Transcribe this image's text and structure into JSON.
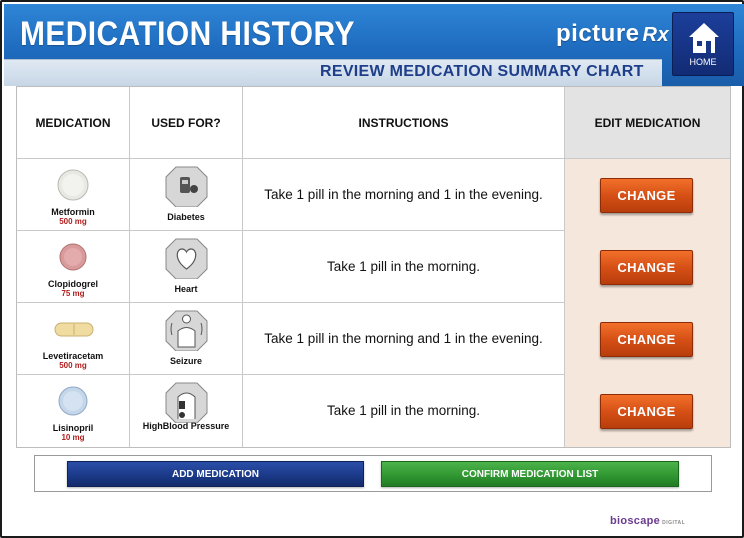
{
  "header": {
    "title": "MEDICATION HISTORY",
    "logo": "picture",
    "logo_rx": "Rx",
    "subtitle": "REVIEW MEDICATION SUMMARY CHART",
    "home_label": "HOME"
  },
  "table": {
    "headers": {
      "medication": "MEDICATION",
      "used_for": "USED FOR?",
      "instructions": "INSTRUCTIONS",
      "edit": "EDIT MEDICATION"
    },
    "rows": [
      {
        "medication": "Metformin",
        "dose": "500 mg",
        "used_for": "Diabetes",
        "instructions": "Take 1 pill in the morning and 1 in the evening.",
        "action": "CHANGE"
      },
      {
        "medication": "Clopidogrel",
        "dose": "75 mg",
        "used_for": "Heart",
        "instructions": "Take 1 pill in the morning.",
        "action": "CHANGE"
      },
      {
        "medication": "Levetiracetam",
        "dose": "500 mg",
        "used_for": "Seizure",
        "instructions": "Take 1 pill in the morning and 1 in the evening.",
        "action": "CHANGE"
      },
      {
        "medication": "Lisinopril",
        "dose": "10 mg",
        "used_for": "HighBlood Pressure",
        "instructions": "Take 1 pill in the morning.",
        "action": "CHANGE"
      }
    ]
  },
  "actions": {
    "add": "ADD MEDICATION",
    "confirm": "CONFIRM MEDICATION LIST"
  },
  "footer": {
    "logo": "bioscape",
    "logo_sub": "DIGITAL"
  },
  "colors": {
    "header_blue": "#1e6bbf",
    "change_orange": "#d65016",
    "add_blue": "#1a3886",
    "confirm_green": "#2e9530",
    "dose_red": "#b01d1d"
  },
  "icons": {
    "home": "house-icon",
    "diabetes": "glucose-meter-icon",
    "heart": "heart-icon",
    "seizure": "person-seizure-icon",
    "blood_pressure": "blood-pressure-cuff-icon"
  }
}
